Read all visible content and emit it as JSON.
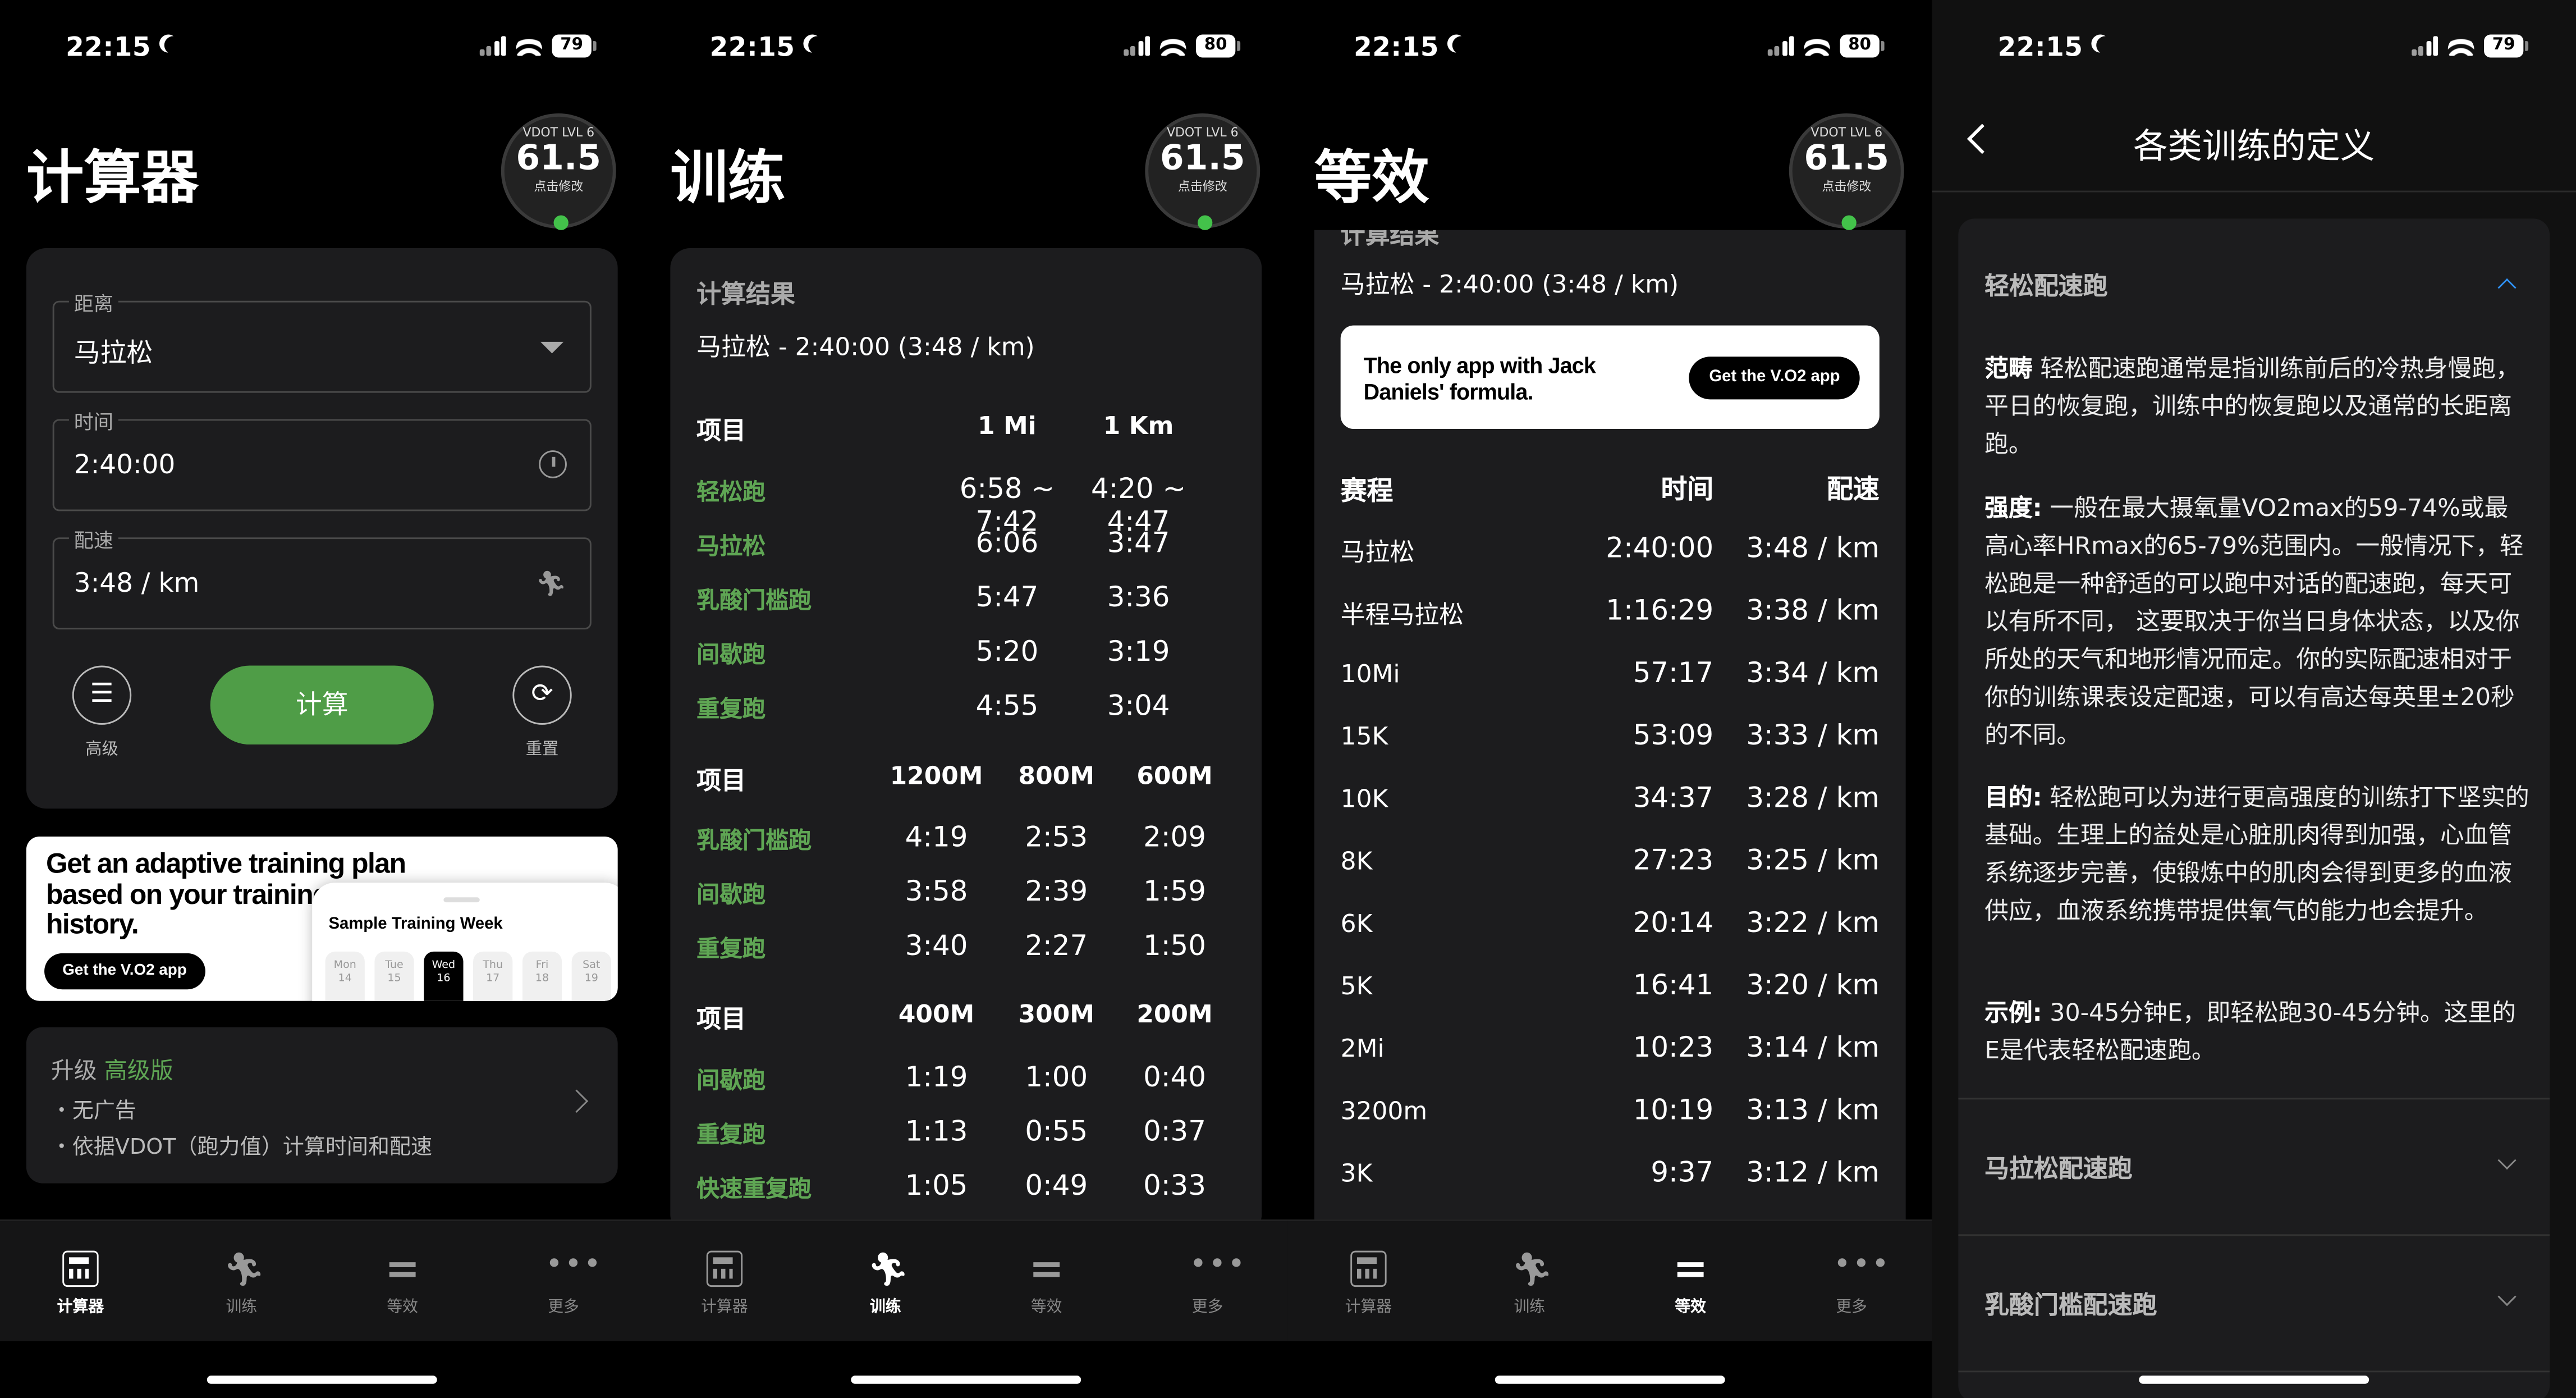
{
  "status": {
    "time": "22:15",
    "battery": [
      "79",
      "80",
      "80",
      "79"
    ]
  },
  "vdot": {
    "level": "VDOT LVL 6",
    "value": "61.5",
    "hint": "点击修改"
  },
  "screen1": {
    "title": "计算器",
    "fields": [
      {
        "label": "距离",
        "value": "马拉松"
      },
      {
        "label": "时间",
        "value": "2:40:00"
      },
      {
        "label": "配速",
        "value": "3:48 / km"
      }
    ],
    "advanced_label": "高级",
    "calc_label": "计算",
    "reset_label": "重置",
    "ad": {
      "headline": "Get an adaptive training plan based on your training history.",
      "button": "Get the V.O2 app",
      "preview_title": "Sample Training Week",
      "days": [
        "Mon",
        "Tue",
        "Wed",
        "Thu",
        "Fri",
        "Sat"
      ],
      "dates": [
        "14",
        "15",
        "16",
        "17",
        "18",
        "19"
      ]
    },
    "upgrade": {
      "prefix": "升级",
      "tier": "高级版",
      "line1": "・无广告",
      "line2": "・依据VDOT（跑力值）计算时间和配速"
    }
  },
  "tabs": [
    {
      "label": "计算器",
      "icon": "calculator-icon"
    },
    {
      "label": "训练",
      "icon": "running-icon"
    },
    {
      "label": "等效",
      "icon": "equals-icon"
    },
    {
      "label": "更多",
      "icon": "more-icon"
    }
  ],
  "screen2": {
    "title": "训练",
    "result_label": "计算结果",
    "result": "马拉松 - 2:40:00 (3:48 / km)",
    "tables": [
      {
        "header": [
          "项目",
          "1 Mi",
          "1 Km"
        ],
        "rows": [
          [
            "轻松跑",
            "6:58 ~ 7:42",
            "4:20 ~ 4:47"
          ],
          [
            "马拉松",
            "6:06",
            "3:47"
          ],
          [
            "乳酸门槛跑",
            "5:47",
            "3:36"
          ],
          [
            "间歇跑",
            "5:20",
            "3:19"
          ],
          [
            "重复跑",
            "4:55",
            "3:04"
          ]
        ]
      },
      {
        "header": [
          "项目",
          "1200M",
          "800M",
          "600M"
        ],
        "rows": [
          [
            "乳酸门槛跑",
            "4:19",
            "2:53",
            "2:09"
          ],
          [
            "间歇跑",
            "3:58",
            "2:39",
            "1:59"
          ],
          [
            "重复跑",
            "3:40",
            "2:27",
            "1:50"
          ]
        ]
      },
      {
        "header": [
          "项目",
          "400M",
          "300M",
          "200M"
        ],
        "rows": [
          [
            "间歇跑",
            "1:19",
            "1:00",
            "0:40"
          ],
          [
            "重复跑",
            "1:13",
            "0:55",
            "0:37"
          ],
          [
            "快速重复跑",
            "1:05",
            "0:49",
            "0:33"
          ]
        ]
      }
    ]
  },
  "screen3": {
    "title": "等效",
    "result_label": "计算结果",
    "result": "马拉松 - 2:40:00 (3:48 / km)",
    "ad_text": "The only app with Jack Daniels' formula.",
    "ad_button": "Get the V.O2 app",
    "header": [
      "赛程",
      "时间",
      "配速"
    ],
    "rows": [
      [
        "马拉松",
        "2:40:00",
        "3:48 / km"
      ],
      [
        "半程马拉松",
        "1:16:29",
        "3:38 / km"
      ],
      [
        "10Mi",
        "57:17",
        "3:34 / km"
      ],
      [
        "15K",
        "53:09",
        "3:33 / km"
      ],
      [
        "10K",
        "34:37",
        "3:28 / km"
      ],
      [
        "8K",
        "27:23",
        "3:25 / km"
      ],
      [
        "6K",
        "20:14",
        "3:22 / km"
      ],
      [
        "5K",
        "16:41",
        "3:20 / km"
      ],
      [
        "2Mi",
        "10:23",
        "3:14 / km"
      ],
      [
        "3200m",
        "10:19",
        "3:13 / km"
      ],
      [
        "3K",
        "9:37",
        "3:12 / km"
      ]
    ]
  },
  "screen4": {
    "title": "各类训练的定义",
    "sections": [
      {
        "title": "轻松配速跑",
        "expanded": true
      },
      {
        "title": "马拉松配速跑",
        "expanded": false
      },
      {
        "title": "乳酸门槛配速跑",
        "expanded": false
      }
    ],
    "paras": [
      {
        "key": "范畴",
        "text": " 轻松配速跑通常是指训练前后的冷热身慢跑，平日的恢复跑，训练中的恢复跑以及通常的长距离跑。"
      },
      {
        "key": "强度:",
        "text": " 一般在最大摄氧量VO2max的59-74%或最高心率HRmax的65-79%范围内。一般情况下，轻松跑是一种舒适的可以跑中对话的配速跑，每天可以有所不同， 这要取决于你当日身体状态，以及你所处的天气和地形情况而定。你的实际配速相对于你的训练课表设定配速，可以有高达每英里±20秒的不同。"
      },
      {
        "key": "目的:",
        "text": " 轻松跑可以为进行更高强度的训练打下坚实的基础。生理上的益处是心脏肌肉得到加强，心血管系统逐步完善，使锻炼中的肌肉会得到更多的血液供应，血液系统携带提供氧气的能力也会提升。"
      },
      {
        "key": "示例:",
        "text": " 30-45分钟E，即轻松跑30-45分钟。这里的E是代表轻松配速跑。"
      }
    ]
  },
  "colors": {
    "accent_green": "#4f9d47",
    "label_green": "#5fa654",
    "card": "#1c1c1e",
    "chevron_blue": "#2f8ff0"
  }
}
